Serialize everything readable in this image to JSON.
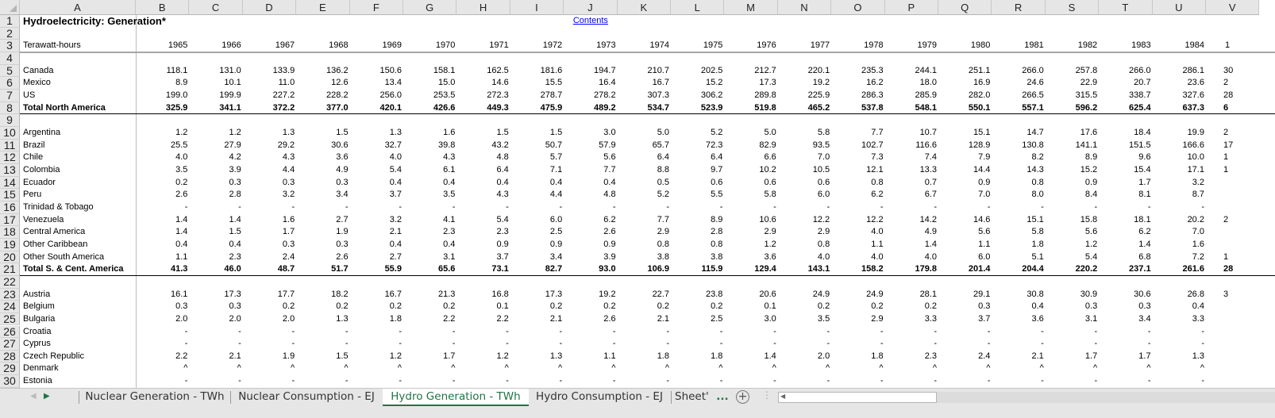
{
  "sheet": {
    "columns": [
      "A",
      "B",
      "C",
      "D",
      "E",
      "F",
      "G",
      "H",
      "I",
      "J",
      "K",
      "L",
      "M",
      "N",
      "O",
      "P",
      "Q",
      "R",
      "S",
      "T",
      "U",
      "V"
    ],
    "title": "Hydroelectricity: Generation*",
    "contents_link": "Contents",
    "unit_label": "Terawatt-hours",
    "years": [
      "1965",
      "1966",
      "1967",
      "1968",
      "1969",
      "1970",
      "1971",
      "1972",
      "1973",
      "1974",
      "1975",
      "1976",
      "1977",
      "1978",
      "1979",
      "1980",
      "1981",
      "1982",
      "1983",
      "1984"
    ],
    "years_partial_next": "1",
    "rows": [
      {
        "row": 5,
        "label": "Canada",
        "values": [
          "118.1",
          "131.0",
          "133.9",
          "136.2",
          "150.6",
          "158.1",
          "162.5",
          "181.6",
          "194.7",
          "210.7",
          "202.5",
          "212.7",
          "220.1",
          "235.3",
          "244.1",
          "251.1",
          "266.0",
          "257.8",
          "266.0",
          "286.1"
        ],
        "partial": "30"
      },
      {
        "row": 6,
        "label": "Mexico",
        "values": [
          "8.9",
          "10.1",
          "11.0",
          "12.6",
          "13.4",
          "15.0",
          "14.6",
          "15.5",
          "16.4",
          "16.7",
          "15.2",
          "17.3",
          "19.2",
          "16.2",
          "18.0",
          "16.9",
          "24.6",
          "22.9",
          "20.7",
          "23.6"
        ],
        "partial": "2"
      },
      {
        "row": 7,
        "label": "US",
        "values": [
          "199.0",
          "199.9",
          "227.2",
          "228.2",
          "256.0",
          "253.5",
          "272.3",
          "278.7",
          "278.2",
          "307.3",
          "306.2",
          "289.8",
          "225.9",
          "286.3",
          "285.9",
          "282.0",
          "266.5",
          "315.5",
          "338.7",
          "327.6"
        ],
        "partial": "28"
      },
      {
        "row": 8,
        "label": "Total North America",
        "bold": true,
        "values": [
          "325.9",
          "341.1",
          "372.2",
          "377.0",
          "420.1",
          "426.6",
          "449.3",
          "475.9",
          "489.2",
          "534.7",
          "523.9",
          "519.8",
          "465.2",
          "537.8",
          "548.1",
          "550.1",
          "557.1",
          "596.2",
          "625.4",
          "637.3"
        ],
        "partial": "6"
      },
      {
        "row": 10,
        "label": "Argentina",
        "values": [
          "1.2",
          "1.2",
          "1.3",
          "1.5",
          "1.3",
          "1.6",
          "1.5",
          "1.5",
          "3.0",
          "5.0",
          "5.2",
          "5.0",
          "5.8",
          "7.7",
          "10.7",
          "15.1",
          "14.7",
          "17.6",
          "18.4",
          "19.9"
        ],
        "partial": "2"
      },
      {
        "row": 11,
        "label": "Brazil",
        "values": [
          "25.5",
          "27.9",
          "29.2",
          "30.6",
          "32.7",
          "39.8",
          "43.2",
          "50.7",
          "57.9",
          "65.7",
          "72.3",
          "82.9",
          "93.5",
          "102.7",
          "116.6",
          "128.9",
          "130.8",
          "141.1",
          "151.5",
          "166.6"
        ],
        "partial": "17"
      },
      {
        "row": 12,
        "label": "Chile",
        "values": [
          "4.0",
          "4.2",
          "4.3",
          "3.6",
          "4.0",
          "4.3",
          "4.8",
          "5.7",
          "5.6",
          "6.4",
          "6.4",
          "6.6",
          "7.0",
          "7.3",
          "7.4",
          "7.9",
          "8.2",
          "8.9",
          "9.6",
          "10.0"
        ],
        "partial": "1"
      },
      {
        "row": 13,
        "label": "Colombia",
        "values": [
          "3.5",
          "3.9",
          "4.4",
          "4.9",
          "5.4",
          "6.1",
          "6.4",
          "7.1",
          "7.7",
          "8.8",
          "9.7",
          "10.2",
          "10.5",
          "12.1",
          "13.3",
          "14.4",
          "14.3",
          "15.2",
          "15.4",
          "17.1"
        ],
        "partial": "1"
      },
      {
        "row": 14,
        "label": "Ecuador",
        "values": [
          "0.2",
          "0.3",
          "0.3",
          "0.3",
          "0.4",
          "0.4",
          "0.4",
          "0.4",
          "0.4",
          "0.5",
          "0.6",
          "0.6",
          "0.6",
          "0.8",
          "0.7",
          "0.9",
          "0.8",
          "0.9",
          "1.7",
          "3.2"
        ],
        "partial": ""
      },
      {
        "row": 15,
        "label": "Peru",
        "values": [
          "2.6",
          "2.8",
          "3.2",
          "3.4",
          "3.7",
          "3.5",
          "4.3",
          "4.4",
          "4.8",
          "5.2",
          "5.5",
          "5.8",
          "6.0",
          "6.2",
          "6.7",
          "7.0",
          "8.0",
          "8.4",
          "8.1",
          "8.7"
        ],
        "partial": ""
      },
      {
        "row": 16,
        "label": "Trinidad & Tobago",
        "values": [
          "-",
          "-",
          "-",
          "-",
          "-",
          "-",
          "-",
          "-",
          "-",
          "-",
          "-",
          "-",
          "-",
          "-",
          "-",
          "-",
          "-",
          "-",
          "-",
          "-"
        ],
        "partial": ""
      },
      {
        "row": 17,
        "label": "Venezuela",
        "values": [
          "1.4",
          "1.4",
          "1.6",
          "2.7",
          "3.2",
          "4.1",
          "5.4",
          "6.0",
          "6.2",
          "7.7",
          "8.9",
          "10.6",
          "12.2",
          "12.2",
          "14.2",
          "14.6",
          "15.1",
          "15.8",
          "18.1",
          "20.2"
        ],
        "partial": "2"
      },
      {
        "row": 18,
        "label": "Central America",
        "values": [
          "1.4",
          "1.5",
          "1.7",
          "1.9",
          "2.1",
          "2.3",
          "2.3",
          "2.5",
          "2.6",
          "2.9",
          "2.8",
          "2.9",
          "2.9",
          "4.0",
          "4.9",
          "5.6",
          "5.8",
          "5.6",
          "6.2",
          "7.0"
        ],
        "partial": ""
      },
      {
        "row": 19,
        "label": "Other Caribbean",
        "values": [
          "0.4",
          "0.4",
          "0.3",
          "0.3",
          "0.4",
          "0.4",
          "0.9",
          "0.9",
          "0.9",
          "0.8",
          "0.8",
          "1.2",
          "0.8",
          "1.1",
          "1.4",
          "1.1",
          "1.8",
          "1.2",
          "1.4",
          "1.6"
        ],
        "partial": ""
      },
      {
        "row": 20,
        "label": "Other South America",
        "values": [
          "1.1",
          "2.3",
          "2.4",
          "2.6",
          "2.7",
          "3.1",
          "3.7",
          "3.4",
          "3.9",
          "3.8",
          "3.8",
          "3.6",
          "4.0",
          "4.0",
          "4.0",
          "6.0",
          "5.1",
          "5.4",
          "6.8",
          "7.2"
        ],
        "partial": "1"
      },
      {
        "row": 21,
        "label": "Total S. & Cent. America",
        "bold": true,
        "values": [
          "41.3",
          "46.0",
          "48.7",
          "51.7",
          "55.9",
          "65.6",
          "73.1",
          "82.7",
          "93.0",
          "106.9",
          "115.9",
          "129.4",
          "143.1",
          "158.2",
          "179.8",
          "201.4",
          "204.4",
          "220.2",
          "237.1",
          "261.6"
        ],
        "partial": "28"
      },
      {
        "row": 23,
        "label": "Austria",
        "values": [
          "16.1",
          "17.3",
          "17.7",
          "18.2",
          "16.7",
          "21.3",
          "16.8",
          "17.3",
          "19.2",
          "22.7",
          "23.8",
          "20.6",
          "24.9",
          "24.9",
          "28.1",
          "29.1",
          "30.8",
          "30.9",
          "30.6",
          "26.8"
        ],
        "partial": "3"
      },
      {
        "row": 24,
        "label": "Belgium",
        "values": [
          "0.3",
          "0.3",
          "0.2",
          "0.2",
          "0.2",
          "0.2",
          "0.1",
          "0.2",
          "0.2",
          "0.2",
          "0.2",
          "0.1",
          "0.2",
          "0.2",
          "0.2",
          "0.3",
          "0.4",
          "0.3",
          "0.3",
          "0.4"
        ],
        "partial": ""
      },
      {
        "row": 25,
        "label": "Bulgaria",
        "values": [
          "2.0",
          "2.0",
          "2.0",
          "1.3",
          "1.8",
          "2.2",
          "2.2",
          "2.1",
          "2.6",
          "2.1",
          "2.5",
          "3.0",
          "3.5",
          "2.9",
          "3.3",
          "3.7",
          "3.6",
          "3.1",
          "3.4",
          "3.3"
        ],
        "partial": ""
      },
      {
        "row": 26,
        "label": "Croatia",
        "values": [
          "-",
          "-",
          "-",
          "-",
          "-",
          "-",
          "-",
          "-",
          "-",
          "-",
          "-",
          "-",
          "-",
          "-",
          "-",
          "-",
          "-",
          "-",
          "-",
          "-"
        ],
        "partial": ""
      },
      {
        "row": 27,
        "label": "Cyprus",
        "values": [
          "-",
          "-",
          "-",
          "-",
          "-",
          "-",
          "-",
          "-",
          "-",
          "-",
          "-",
          "-",
          "-",
          "-",
          "-",
          "-",
          "-",
          "-",
          "-",
          "-"
        ],
        "partial": ""
      },
      {
        "row": 28,
        "label": "Czech Republic",
        "values": [
          "2.2",
          "2.1",
          "1.9",
          "1.5",
          "1.2",
          "1.7",
          "1.2",
          "1.3",
          "1.1",
          "1.8",
          "1.8",
          "1.4",
          "2.0",
          "1.8",
          "2.3",
          "2.4",
          "2.1",
          "1.7",
          "1.7",
          "1.3"
        ],
        "partial": ""
      },
      {
        "row": 29,
        "label": "Denmark",
        "values": [
          "^",
          "^",
          "^",
          "^",
          "^",
          "^",
          "^",
          "^",
          "^",
          "^",
          "^",
          "^",
          "^",
          "^",
          "^",
          "^",
          "^",
          "^",
          "^",
          "^"
        ],
        "partial": ""
      },
      {
        "row": 30,
        "label": "Estonia",
        "values": [
          "-",
          "-",
          "-",
          "-",
          "-",
          "-",
          "-",
          "-",
          "-",
          "-",
          "-",
          "-",
          "-",
          "-",
          "-",
          "-",
          "-",
          "-",
          "-",
          "-"
        ],
        "partial": ""
      }
    ]
  },
  "tabs": {
    "items": [
      {
        "label": "Nuclear Generation - TWh",
        "active": false
      },
      {
        "label": "Nuclear Consumption - EJ",
        "active": false
      },
      {
        "label": "Hydro Generation - TWh",
        "active": true
      },
      {
        "label": "Hydro Consumption - EJ",
        "active": false
      },
      {
        "label": "Sheet'",
        "active": false
      }
    ],
    "more_label": "...",
    "add_icon": "plus-circle-icon",
    "active_color": "#217346"
  }
}
